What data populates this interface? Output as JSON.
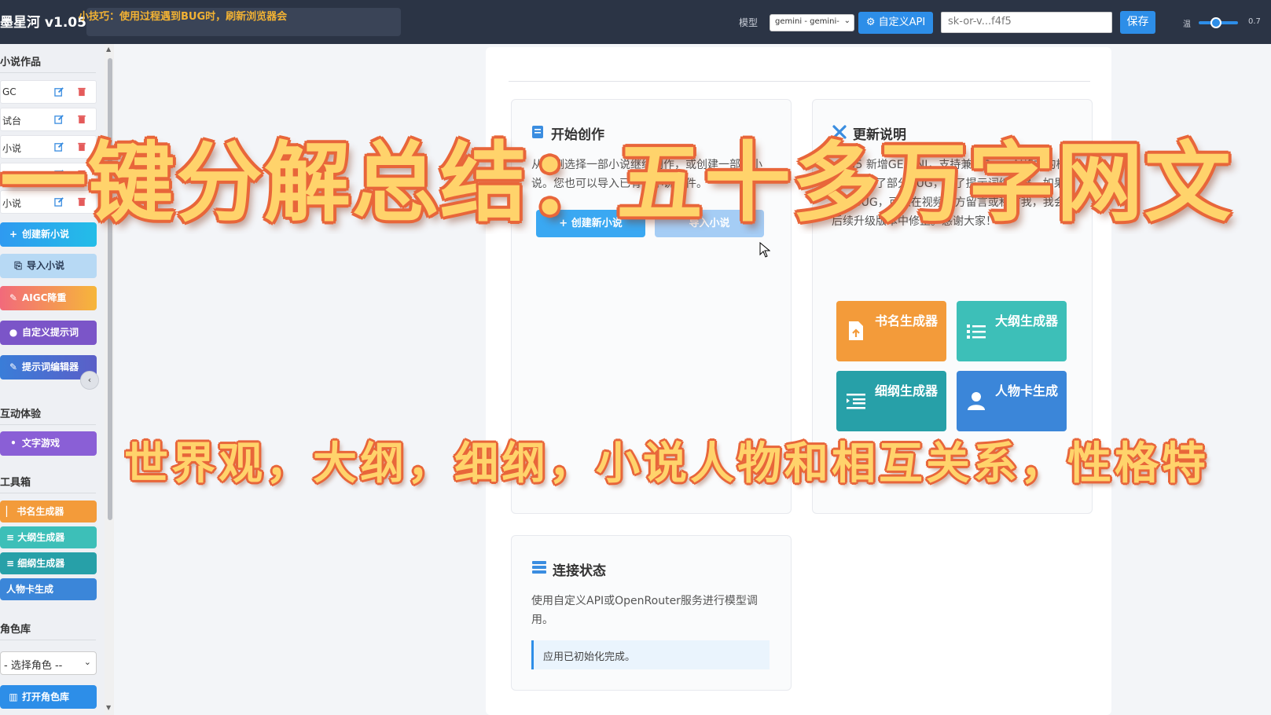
{
  "header": {
    "app_title": "墨星河 v1.05",
    "tip": "小技巧：使用过程遇到BUG时，刷新浏览器会",
    "model_label": "模型",
    "model_value": "gemini - gemini-",
    "custom_api_label": "自定义API",
    "api_key_value": "sk-or-v...f4f5",
    "save_label": "保存",
    "temperature_label": "温",
    "temperature_value": "0.7",
    "temperature_fraction": 0.7
  },
  "sidebar": {
    "novels_title": "小说作品",
    "novels": [
      {
        "name": "GC"
      },
      {
        "name": "试台"
      },
      {
        "name": "小说"
      },
      {
        "name": "纲"
      },
      {
        "name": "小说"
      }
    ],
    "create_novel": "创建新小说",
    "import_novel": "导入小说",
    "aigc_reduce": "AIGC降重",
    "custom_prompt": "自定义提示词",
    "prompt_editor": "提示词编辑器",
    "interactive_title": "互动体验",
    "text_game": "文字游戏",
    "toolbox_title": "工具箱",
    "tools": [
      "书名生成器",
      "大纲生成器",
      "细纲生成器",
      "人物卡生成"
    ],
    "role_lib_title": "角色库",
    "role_select": "- 选择角色 --",
    "open_role_lib": "打开角色库"
  },
  "main": {
    "start": {
      "title": "开始创作",
      "text": "从左侧选择一部小说继续创作，或创建一部新小说。您也可以导入已有的小说文件。",
      "create_btn": "创建新小说",
      "import_btn": "导入小说"
    },
    "update": {
      "title": "更新说明",
      "text": "v1.05 新增GEMINI，支持兼容OpenAI格式的模型，修复了部分BUG，加了提示词编辑器。如果发现BUG，可以在视频下方留言或私信我，我会后续升级版本中修正。感谢大家！",
      "tiles": [
        {
          "label": "书名生成器",
          "color": "#f39b3a"
        },
        {
          "label": "大纲生成器",
          "color": "#3dbfb8"
        },
        {
          "label": "细纲生成器",
          "color": "#27a0a8"
        },
        {
          "label": "人物卡生成",
          "color": "#3b86d9"
        }
      ]
    },
    "status": {
      "title": "连接状态",
      "text": "使用自定义API或OpenRouter服务进行模型调用。",
      "note": "应用已初始化完成。"
    }
  },
  "overlay": {
    "title": "一键分解总结：五十多万字网文",
    "subtitle": "世界观，大纲，细纲，小说人物和相互关系，性格特"
  }
}
